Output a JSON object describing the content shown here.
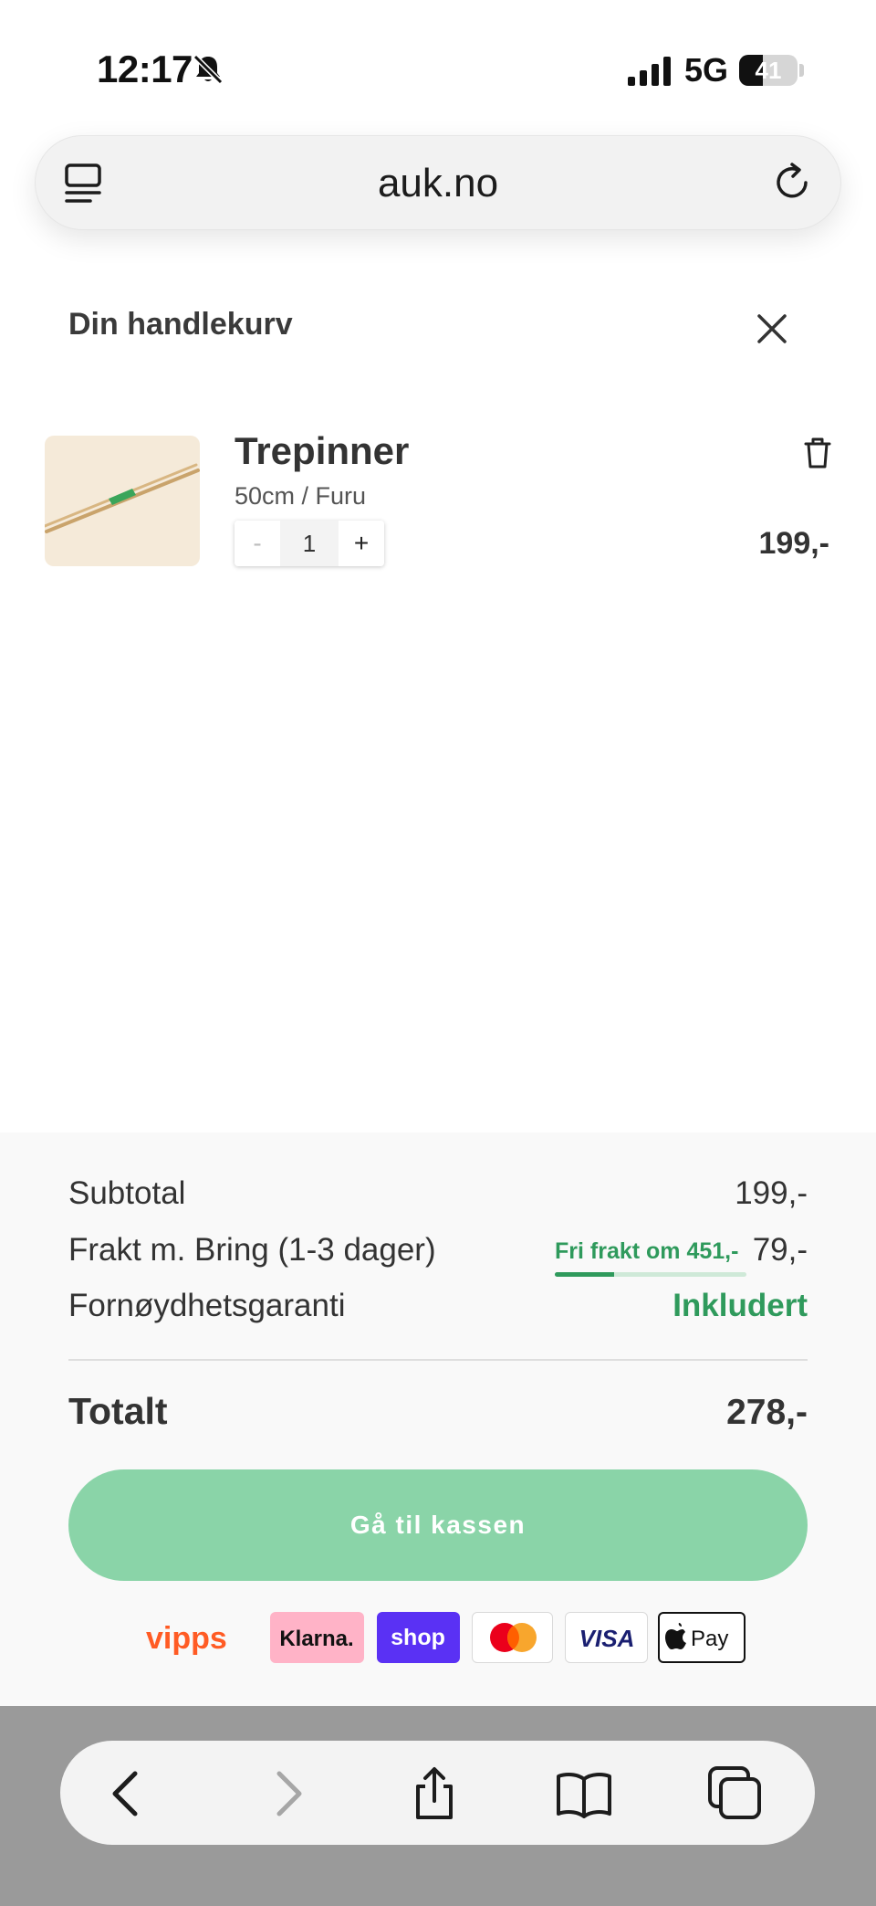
{
  "status_bar": {
    "time": "12:17",
    "network": "5G",
    "battery": "41",
    "battery_level": 0.41
  },
  "browser": {
    "url": "auk.no"
  },
  "cart": {
    "title": "Din handlekurv",
    "items": [
      {
        "name": "Trepinner",
        "variant": "50cm / Furu",
        "quantity": "1",
        "minus": "-",
        "plus": "+",
        "price": "199,-"
      }
    ]
  },
  "summary": {
    "subtotal_label": "Subtotal",
    "subtotal_value": "199,-",
    "shipping_label": "Frakt m. Bring (1-3 dager)",
    "shipping_value": "79,-",
    "free_shipping_note": "Fri frakt om 451,-",
    "free_shipping_progress": 0.31,
    "guarantee_label": "Fornøydhetsgaranti",
    "guarantee_value": "Inkludert",
    "total_label": "Totalt",
    "total_value": "278,-",
    "checkout_label": "Gå til kassen"
  },
  "payment_methods": {
    "vipps": "vipps",
    "klarna": "Klarna.",
    "shop": "shop",
    "visa": "VISA",
    "applepay": "Pay"
  },
  "colors": {
    "accent_green": "#2f9a5c",
    "checkout_button": "#8ad4a8",
    "vipps_orange": "#ff5b24",
    "klarna_pink": "#ffb3c7",
    "shop_purple": "#5a31f4"
  },
  "icons": [
    "bell-slash-icon",
    "signal-icon",
    "battery-icon",
    "reader-icon",
    "reload-icon",
    "close-icon",
    "trash-icon",
    "back-icon",
    "forward-icon",
    "share-icon",
    "bookmarks-icon",
    "tabs-icon"
  ]
}
